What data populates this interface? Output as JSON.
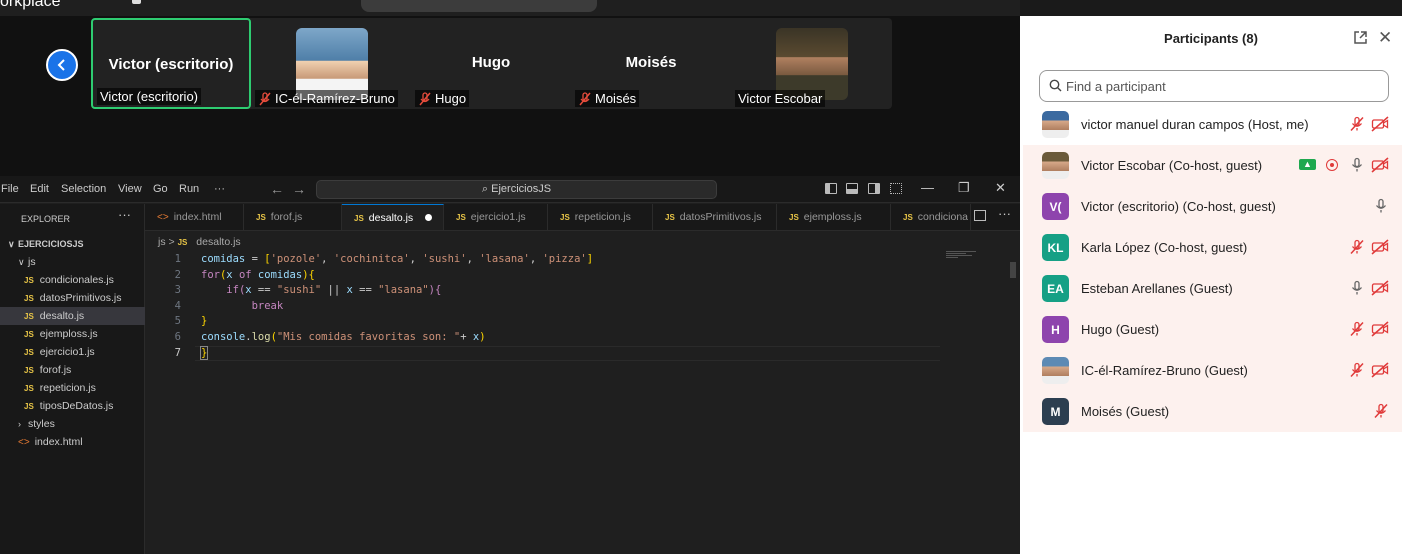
{
  "app": {
    "title": "orkplace"
  },
  "meeting": {
    "tiles": [
      {
        "big_name": "Victor  (escritorio)",
        "label": "Victor  (escritorio)",
        "muted": false,
        "photo": false,
        "active": true
      },
      {
        "big_name": "",
        "label": "IC-él-Ramírez-Bruno",
        "muted": true,
        "photo": true,
        "active": false
      },
      {
        "big_name": "Hugo",
        "label": "Hugo",
        "muted": true,
        "photo": false,
        "active": false
      },
      {
        "big_name": "Moisés",
        "label": "Moisés",
        "muted": true,
        "photo": false,
        "active": false
      },
      {
        "big_name": "",
        "label": "Victor Escobar",
        "muted": false,
        "photo": true,
        "active": false
      }
    ]
  },
  "vscode": {
    "menu": [
      "File",
      "Edit",
      "Selection",
      "View",
      "Go",
      "Run",
      "···"
    ],
    "search": "EjerciciosJS",
    "explorer_title": "EXPLORER",
    "more": "···",
    "tree": {
      "root": "EJERCICIOSJS",
      "js_folder": "js",
      "js_files": [
        "condicionales.js",
        "datosPrimitivos.js",
        "desalto.js",
        "ejemploss.js",
        "ejercicio1.js",
        "forof.js",
        "repeticion.js",
        "tiposDeDatos.js"
      ],
      "styles_folder": "styles",
      "index": "index.html"
    },
    "tabs": [
      {
        "label": "index.html",
        "kind": "html"
      },
      {
        "label": "forof.js",
        "kind": "js"
      },
      {
        "label": "desalto.js",
        "kind": "js",
        "active": true,
        "modified": true
      },
      {
        "label": "ejercicio1.js",
        "kind": "js"
      },
      {
        "label": "repeticion.js",
        "kind": "js"
      },
      {
        "label": "datosPrimitivos.js",
        "kind": "js"
      },
      {
        "label": "ejemploss.js",
        "kind": "js"
      },
      {
        "label": "condiciona",
        "kind": "js"
      }
    ],
    "breadcrumb": {
      "folder": "js",
      "file": "desalto.js",
      "sep": ">",
      "badge": "JS"
    },
    "line_numbers": [
      "1",
      "2",
      "3",
      "4",
      "5",
      "6",
      "7"
    ],
    "code_tokens": {
      "l1": [
        "comidas",
        " = ",
        "[",
        "'pozole'",
        ", ",
        "'cochinitca'",
        ", ",
        "'sushi'",
        ", ",
        "'lasana'",
        ", ",
        "'pizza'",
        "]"
      ],
      "l2": [
        "for",
        "(",
        "x",
        " of ",
        "comidas",
        ")",
        "{"
      ],
      "l3": [
        "    ",
        "if",
        "(",
        "x",
        " == ",
        "\"sushi\"",
        " || ",
        "x",
        " == ",
        "\"lasana\"",
        ")",
        "{"
      ],
      "l4": [
        "        ",
        "break"
      ],
      "l5": [
        "}"
      ],
      "l6": [
        "console",
        ".",
        "log",
        "(",
        "\"Mis comidas favoritas son: \"",
        "+ ",
        "x",
        ")"
      ],
      "l7": [
        "}"
      ]
    }
  },
  "participants": {
    "title": "Participants (8)",
    "search_placeholder": "Find a participant",
    "list": [
      {
        "name": "victor manuel duran campos (Host, me)",
        "initials": "",
        "avatar_color": "#3b6aa0",
        "photo": true,
        "icons": [
          "mic-muted-icon",
          "video-off-icon"
        ],
        "tinted": false
      },
      {
        "name": "Victor Escobar (Co-host, guest)",
        "initials": "",
        "avatar_color": "#6b5a3a",
        "photo": true,
        "icons": [
          "share-screen-icon",
          "record-icon",
          "mic-icon",
          "video-off-icon"
        ],
        "tinted": true
      },
      {
        "name": "Victor  (escritorio) (Co-host, guest)",
        "initials": "V(",
        "avatar_color": "#8e44ad",
        "photo": false,
        "icons": [
          "mic-icon"
        ],
        "tinted": true
      },
      {
        "name": "Karla López (Co-host, guest)",
        "initials": "KL",
        "avatar_color": "#16a085",
        "photo": false,
        "icons": [
          "mic-muted-icon",
          "video-off-icon"
        ],
        "tinted": true
      },
      {
        "name": "Esteban Arellanes (Guest)",
        "initials": "EA",
        "avatar_color": "#16a085",
        "photo": false,
        "icons": [
          "mic-icon",
          "video-off-icon"
        ],
        "tinted": true
      },
      {
        "name": "Hugo (Guest)",
        "initials": "H",
        "avatar_color": "#8e44ad",
        "photo": false,
        "icons": [
          "mic-muted-icon",
          "video-off-icon"
        ],
        "tinted": true
      },
      {
        "name": "IC-él-Ramírez-Bruno (Guest)",
        "initials": "",
        "avatar_color": "#5d8ab4",
        "photo": true,
        "icons": [
          "mic-muted-icon",
          "video-off-icon"
        ],
        "tinted": true
      },
      {
        "name": "Moisés (Guest)",
        "initials": "M",
        "avatar_color": "#2c3e50",
        "photo": false,
        "icons": [
          "mic-muted-icon"
        ],
        "tinted": true
      }
    ]
  }
}
